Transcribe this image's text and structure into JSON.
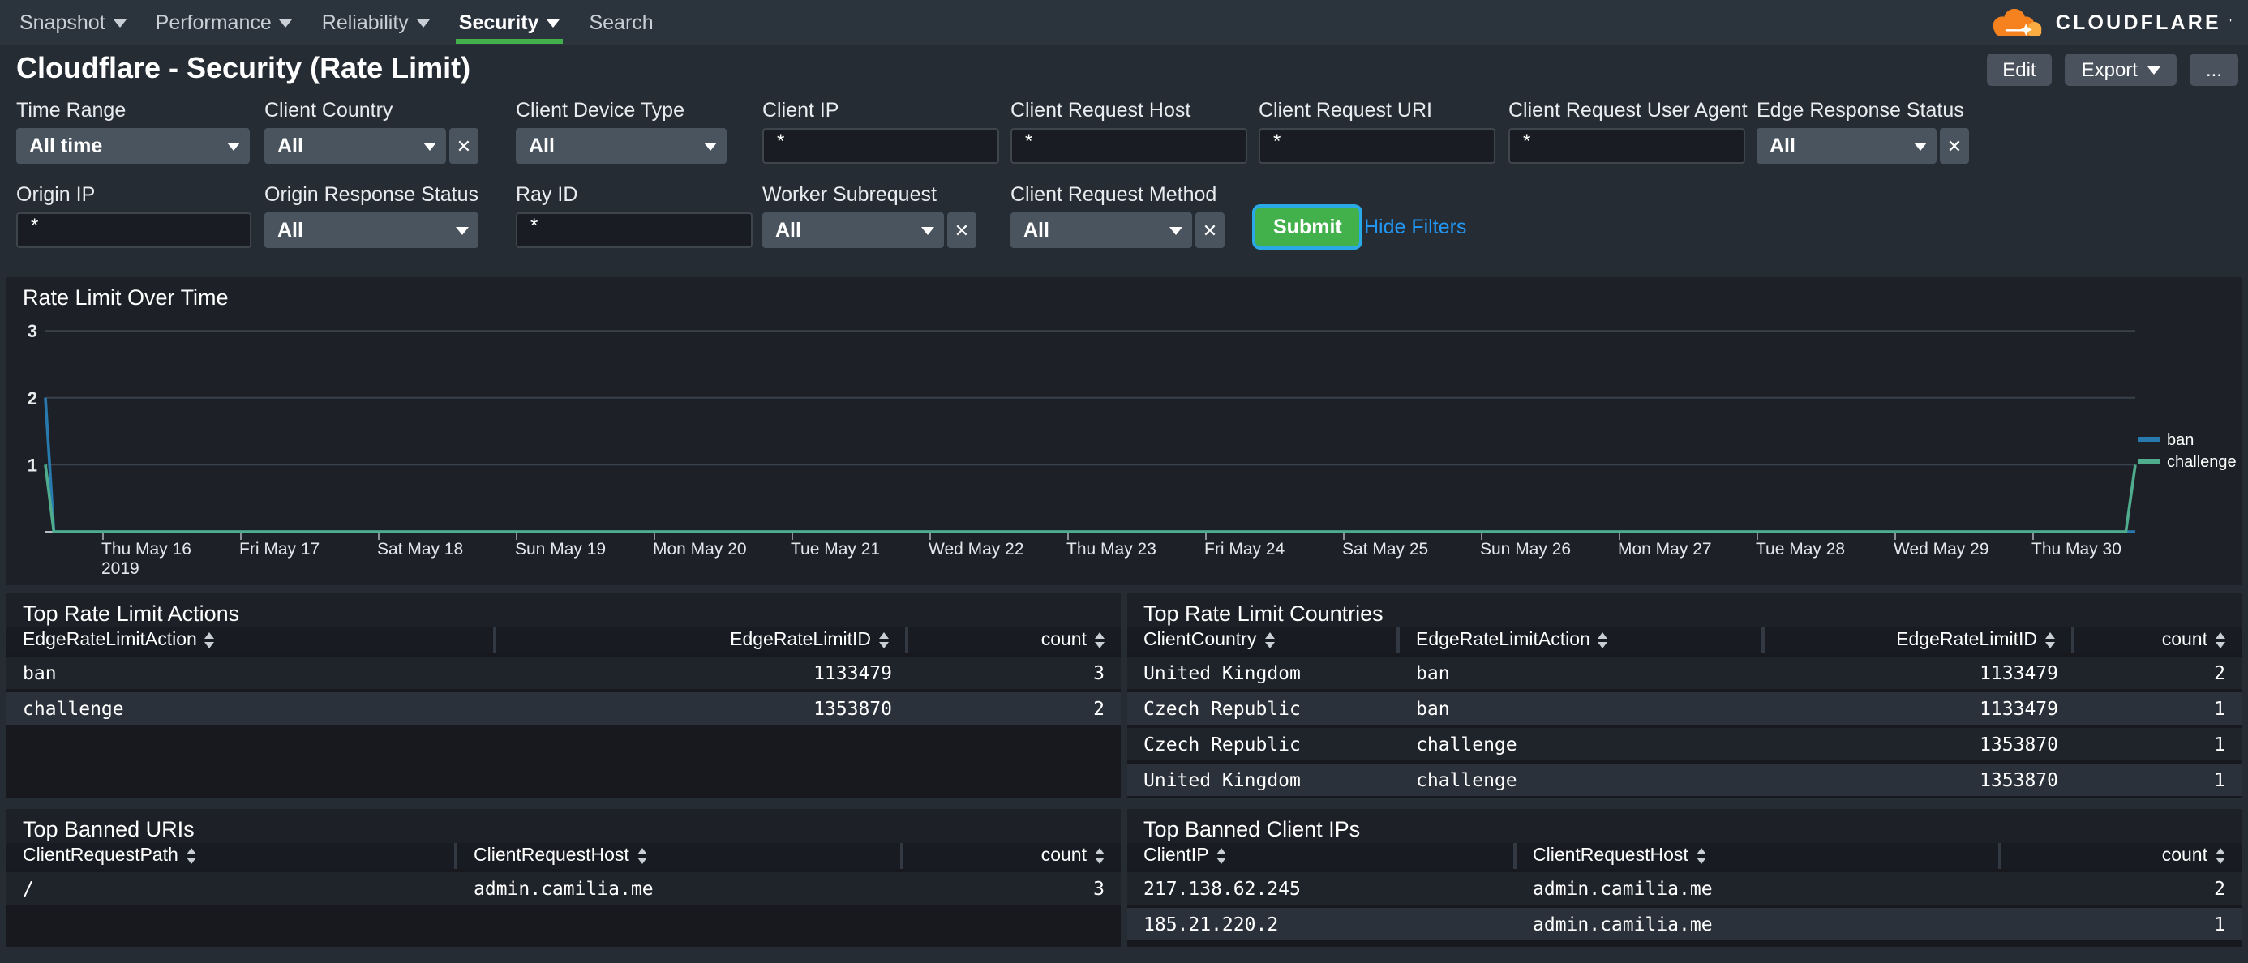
{
  "nav": {
    "items": [
      {
        "label": "Snapshot",
        "caret": true,
        "active": false
      },
      {
        "label": "Performance",
        "caret": true,
        "active": false
      },
      {
        "label": "Reliability",
        "caret": true,
        "active": false
      },
      {
        "label": "Security",
        "caret": true,
        "active": true
      },
      {
        "label": "Search",
        "caret": false,
        "active": false
      }
    ],
    "logo": {
      "text": "CLOUDFLARE",
      "mark": "'"
    }
  },
  "header": {
    "title": "Cloudflare - Security (Rate Limit)",
    "buttons": [
      {
        "label": "Edit",
        "caret": false
      },
      {
        "label": "Export",
        "caret": true
      },
      {
        "label": "...",
        "caret": false
      }
    ]
  },
  "filters": {
    "row1": [
      {
        "label": "Time Range",
        "type": "select",
        "value": "All time",
        "clearable": false
      },
      {
        "label": "Client Country",
        "type": "select",
        "value": "All",
        "clearable": true
      },
      {
        "label": "Client Device Type",
        "type": "select",
        "value": "All",
        "clearable": false
      },
      {
        "label": "Client IP",
        "type": "input",
        "value": "*"
      },
      {
        "label": "Client Request Host",
        "type": "input",
        "value": "*"
      },
      {
        "label": "Client Request URI",
        "type": "input",
        "value": "*"
      },
      {
        "label": "Client Request User Agent",
        "type": "input",
        "value": "*"
      },
      {
        "label": "Edge Response Status",
        "type": "select",
        "value": "All",
        "clearable": true
      }
    ],
    "row2": [
      {
        "label": "Origin IP",
        "type": "input",
        "value": "*"
      },
      {
        "label": "Origin Response Status",
        "type": "select",
        "value": "All",
        "clearable": false
      },
      {
        "label": "Ray ID",
        "type": "input",
        "value": "*"
      },
      {
        "label": "Worker Subrequest",
        "type": "select",
        "value": "All",
        "clearable": true
      },
      {
        "label": "Client Request Method",
        "type": "select",
        "value": "All",
        "clearable": true
      }
    ],
    "submit_label": "Submit",
    "hide_filters_label": "Hide Filters"
  },
  "chart_data": {
    "type": "line",
    "title": "Rate Limit Over Time",
    "x_tick_labels": [
      "Thu May 16",
      "Fri May 17",
      "Sat May 18",
      "Sun May 19",
      "Mon May 20",
      "Tue May 21",
      "Wed May 22",
      "Thu May 23",
      "Fri May 24",
      "Sat May 25",
      "Sun May 26",
      "Mon May 27",
      "Tue May 28",
      "Wed May 29",
      "Thu May 30"
    ],
    "x_first_tick_year": "2019",
    "ylim": [
      0,
      3
    ],
    "yticks": [
      1,
      2,
      3
    ],
    "legend_position": "right",
    "series": [
      {
        "name": "ban",
        "color": "#2779ae",
        "points_xfrac": [
          [
            0,
            2
          ],
          [
            0.004,
            0
          ],
          [
            1,
            0
          ]
        ]
      },
      {
        "name": "challenge",
        "color": "#4fac8c",
        "points_xfrac": [
          [
            0,
            1
          ],
          [
            0.004,
            0
          ],
          [
            0.9955,
            0
          ],
          [
            1,
            1
          ]
        ]
      }
    ]
  },
  "tables": [
    {
      "title": "Top Rate Limit Actions",
      "columns": [
        {
          "label": "EdgeRateLimitAction",
          "align": "left"
        },
        {
          "label": "EdgeRateLimitID",
          "align": "right"
        },
        {
          "label": "count",
          "align": "right"
        }
      ],
      "rows": [
        [
          "ban",
          "1133479",
          "3"
        ],
        [
          "challenge",
          "1353870",
          "2"
        ]
      ]
    },
    {
      "title": "Top Rate Limit Countries",
      "columns": [
        {
          "label": "ClientCountry",
          "align": "left"
        },
        {
          "label": "EdgeRateLimitAction",
          "align": "left"
        },
        {
          "label": "EdgeRateLimitID",
          "align": "right"
        },
        {
          "label": "count",
          "align": "right"
        }
      ],
      "rows": [
        [
          "United Kingdom",
          "ban",
          "1133479",
          "2"
        ],
        [
          "Czech Republic",
          "ban",
          "1133479",
          "1"
        ],
        [
          "Czech Republic",
          "challenge",
          "1353870",
          "1"
        ],
        [
          "United Kingdom",
          "challenge",
          "1353870",
          "1"
        ]
      ]
    },
    {
      "title": "Top Banned URIs",
      "columns": [
        {
          "label": "ClientRequestPath",
          "align": "left"
        },
        {
          "label": "ClientRequestHost",
          "align": "left"
        },
        {
          "label": "count",
          "align": "right"
        }
      ],
      "rows": [
        [
          "/",
          "admin.camilia.me",
          "3"
        ]
      ]
    },
    {
      "title": "Top Banned Client IPs",
      "columns": [
        {
          "label": "ClientIP",
          "align": "left"
        },
        {
          "label": "ClientRequestHost",
          "align": "left"
        },
        {
          "label": "count",
          "align": "right"
        }
      ],
      "rows": [
        [
          "217.138.62.245",
          "admin.camilia.me",
          "2"
        ],
        [
          "185.21.220.2",
          "admin.camilia.me",
          "1"
        ]
      ]
    }
  ],
  "colors": {
    "accent_green": "#43b14b",
    "link_blue": "#2196f3",
    "series_ban": "#2779ae",
    "series_challenge": "#4fac8c"
  }
}
